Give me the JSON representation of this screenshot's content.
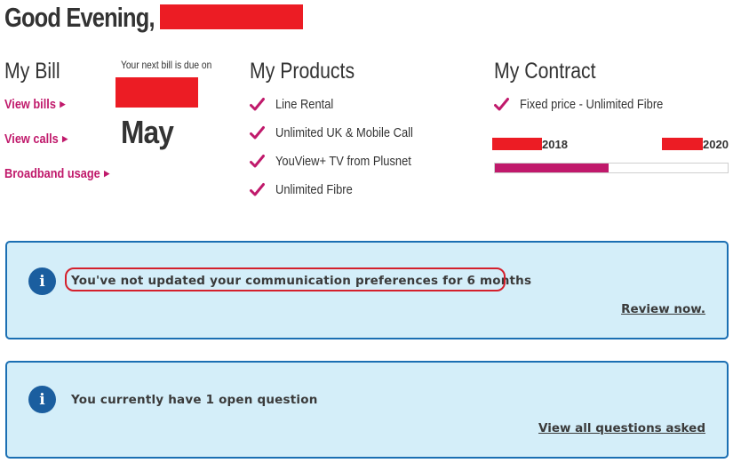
{
  "greeting": {
    "text": "Good Evening,"
  },
  "my_bill": {
    "title": "My Bill",
    "next_bill_label": "Your next bill is due on",
    "due_month": "May",
    "links": [
      {
        "label": "View bills"
      },
      {
        "label": "View calls"
      },
      {
        "label": "Broadband usage"
      }
    ]
  },
  "my_products": {
    "title": "My Products",
    "items": [
      {
        "label": "Line Rental"
      },
      {
        "label": "Unlimited UK & Mobile Call"
      },
      {
        "label": "YouView+ TV from Plusnet"
      },
      {
        "label": "Unlimited Fibre"
      }
    ]
  },
  "my_contract": {
    "title": "My Contract",
    "item": "Fixed price - Unlimited Fibre",
    "start_year": "2018",
    "end_year": "2020",
    "progress_fraction": 0.49
  },
  "alerts": [
    {
      "message": "You've not updated your communication preferences for 6 months",
      "link": "Review now."
    },
    {
      "message": "You currently have 1 open question",
      "link": "View all questions asked"
    }
  ],
  "colors": {
    "brand_pink": "#c0196b",
    "info_blue": "#1b5e9f",
    "panel_bg": "#d4eef9",
    "redaction": "#ec1c24"
  },
  "icons": {
    "check": "checkmark-icon",
    "info": "info-icon",
    "arrow": "chevron-right-icon"
  }
}
